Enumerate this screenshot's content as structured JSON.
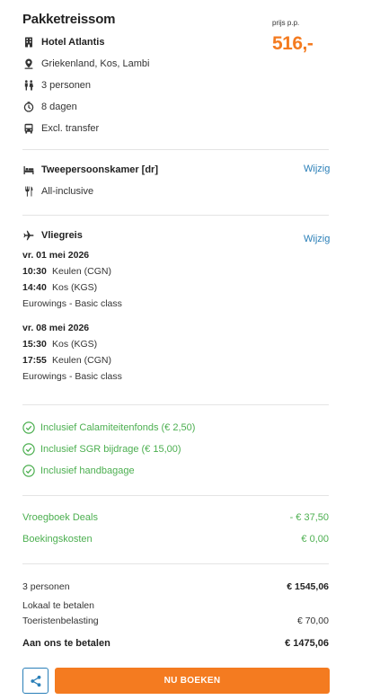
{
  "header": {
    "title": "Pakketreissom",
    "price_label": "prijs p.p.",
    "price": "516,-"
  },
  "summary": {
    "hotel": "Hotel Atlantis",
    "location": "Griekenland, Kos, Lambi",
    "persons": "3 personen",
    "duration": "8 dagen",
    "transfer": "Excl. transfer"
  },
  "room": {
    "type": "Tweepersoonskamer [dr]",
    "board": "All-inclusive",
    "change_label": "Wijzig"
  },
  "flight": {
    "title": "Vliegreis",
    "change_label": "Wijzig",
    "outbound": {
      "date": "vr. 01 mei 2026",
      "dep_time": "10:30",
      "dep_place": "Keulen (CGN)",
      "arr_time": "14:40",
      "arr_place": "Kos (KGS)",
      "carrier": "Eurowings - Basic class"
    },
    "return": {
      "date": "vr. 08 mei 2026",
      "dep_time": "15:30",
      "dep_place": "Kos (KGS)",
      "arr_time": "17:55",
      "arr_place": "Keulen (CGN)",
      "carrier": "Eurowings - Basic class"
    }
  },
  "inclusions": [
    "Inclusief Calamiteitenfonds (€ 2,50)",
    "Inclusief SGR bijdrage (€ 15,00)",
    "Inclusief handbagage"
  ],
  "discounts": {
    "deals_label": "Vroegboek Deals",
    "deals_value": "- € 37,50",
    "booking_label": "Boekingskosten",
    "booking_value": "€ 0,00"
  },
  "totals": {
    "persons_label": "3 personen",
    "persons_value": "€ 1545,06",
    "local_label": "Lokaal te betalen",
    "tax_label": "Toeristenbelasting",
    "tax_value": "€ 70,00",
    "pay_label": "Aan ons te betalen",
    "pay_value": "€ 1475,06"
  },
  "actions": {
    "book_label": "NU BOEKEN"
  },
  "colors": {
    "accent": "#f47b20",
    "link": "#2a7fb8",
    "positive": "#4caf50"
  }
}
